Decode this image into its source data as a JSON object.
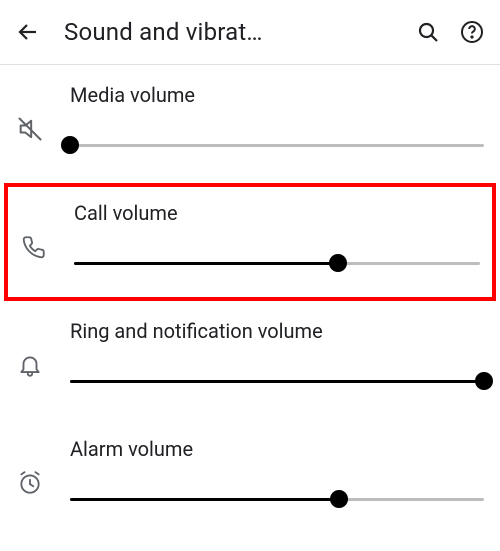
{
  "header": {
    "title": "Sound and vibrat…",
    "icons": {
      "back": "arrow-back",
      "search": "search",
      "help": "help"
    }
  },
  "rows": [
    {
      "id": "media",
      "label": "Media volume",
      "icon": "media-mute",
      "value": 0,
      "highlighted": false
    },
    {
      "id": "call",
      "label": "Call volume",
      "icon": "phone",
      "value": 65,
      "highlighted": true
    },
    {
      "id": "ring",
      "label": "Ring and notification volume",
      "icon": "bell",
      "value": 100,
      "highlighted": false
    },
    {
      "id": "alarm",
      "label": "Alarm volume",
      "icon": "alarm",
      "value": 65,
      "highlighted": false
    }
  ]
}
